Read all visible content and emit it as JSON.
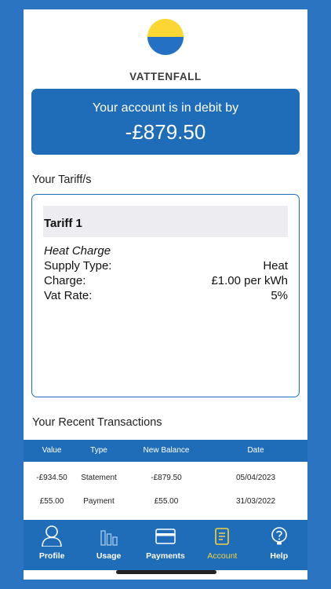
{
  "brand": {
    "name": "VATTENFALL"
  },
  "account": {
    "message": "Your account is in debit by",
    "balance": "-£879.50"
  },
  "tariffs": {
    "title": "Your Tariff/s",
    "items": [
      {
        "heading": "Tariff 1",
        "name": "Heat Charge",
        "rows": [
          {
            "label": "Supply Type:",
            "value": "Heat"
          },
          {
            "label": "Charge:",
            "value": "£1.00 per kWh"
          },
          {
            "label": "Vat Rate:",
            "value": "5%"
          }
        ]
      }
    ]
  },
  "transactions": {
    "title": "Your Recent Transactions",
    "columns": [
      "Value",
      "Type",
      "New Balance",
      "Date"
    ],
    "rows": [
      {
        "value": "-£934.50",
        "type": "Statement",
        "balance": "-£879.50",
        "date": "05/04/2023"
      },
      {
        "value": "£55.00",
        "type": "Payment",
        "balance": "£55.00",
        "date": "31/03/2022"
      }
    ]
  },
  "tabs": [
    {
      "label": "Profile",
      "icon": "profile-icon",
      "active": false
    },
    {
      "label": "Usage",
      "icon": "usage-icon",
      "active": false
    },
    {
      "label": "Payments",
      "icon": "card-icon",
      "active": false
    },
    {
      "label": "Account",
      "icon": "account-icon",
      "active": true
    },
    {
      "label": "Help",
      "icon": "help-icon",
      "active": false
    }
  ],
  "colors": {
    "primary": "#1f6db8",
    "background": "#2b74c1",
    "active_tab": "#f2d23c",
    "logo_yellow": "#fcd733",
    "logo_blue": "#2470c4"
  }
}
